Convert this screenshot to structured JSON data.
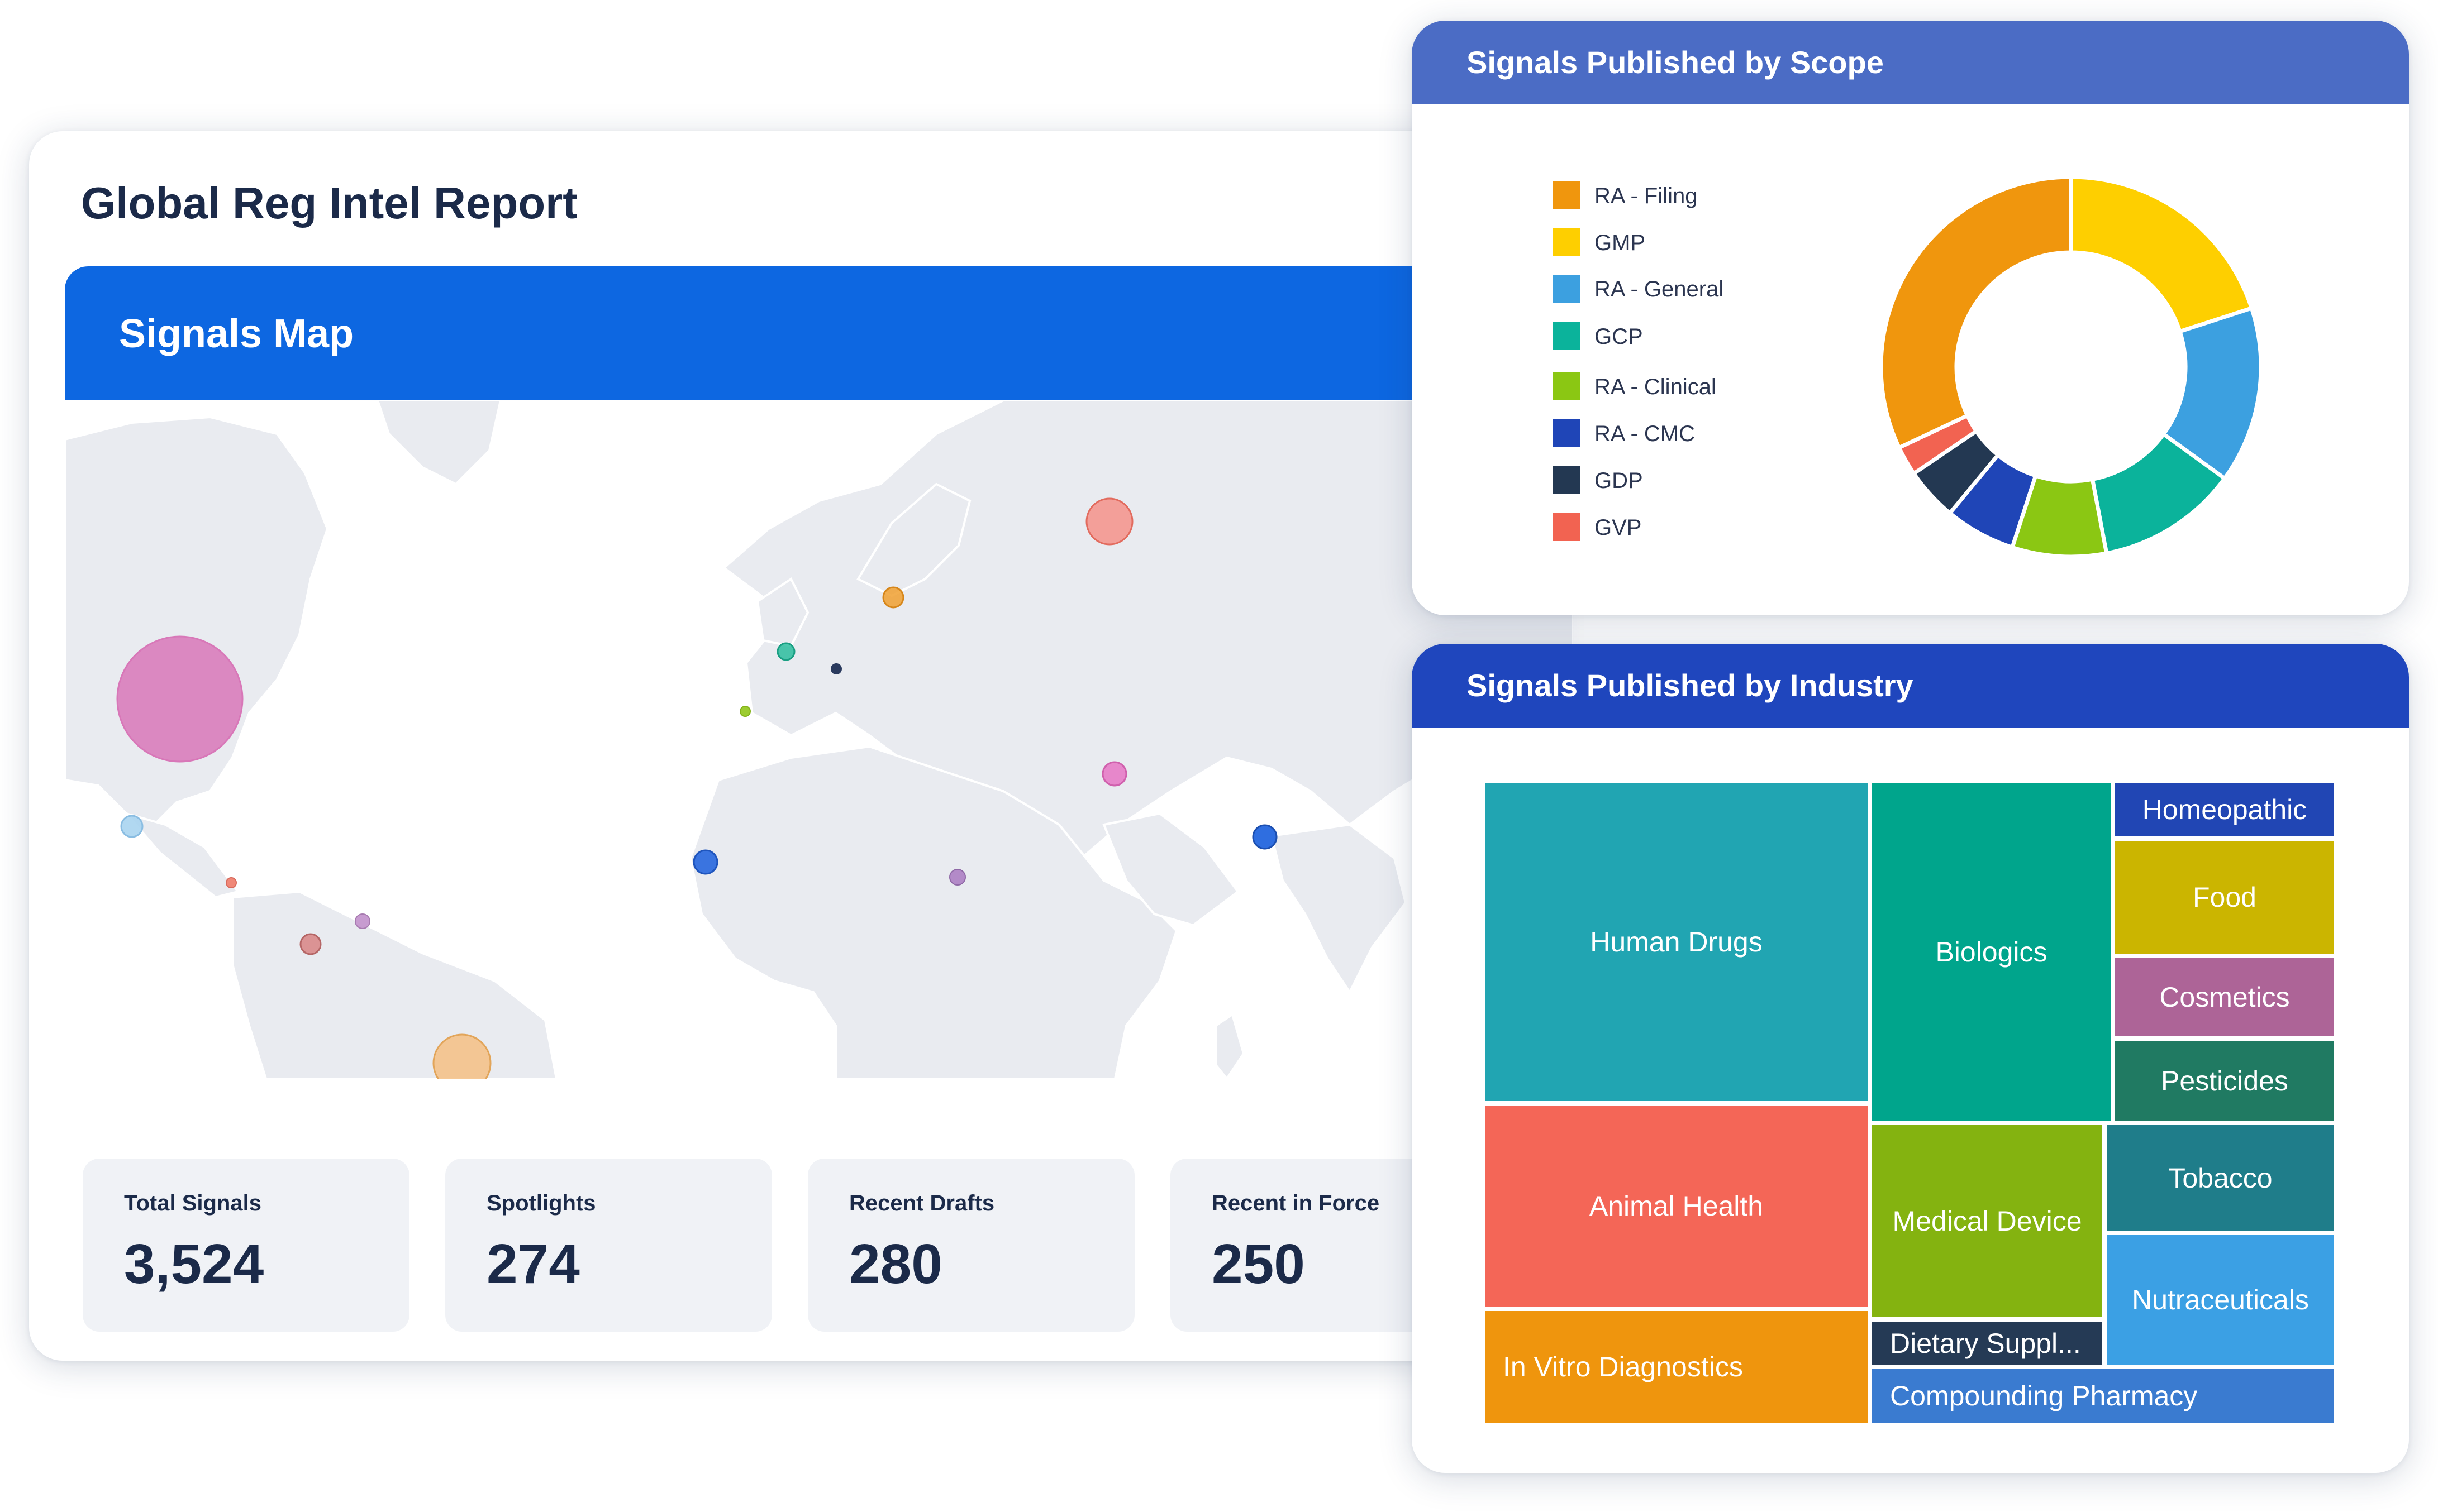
{
  "report": {
    "title": "Global Reg Intel Report"
  },
  "map": {
    "title": "Signals Map"
  },
  "stats": [
    {
      "label": "Total Signals",
      "value": "3,524"
    },
    {
      "label": "Spotlights",
      "value": "274"
    },
    {
      "label": "Recent Drafts",
      "value": "280"
    },
    {
      "label": "Recent in Force",
      "value": "250"
    }
  ],
  "scope": {
    "title": "Signals Published by Scope",
    "header_color": "#4b6cc5",
    "legend": [
      {
        "label": "RA - Filing",
        "color": "#f0960d"
      },
      {
        "label": "GMP",
        "color": "#fecf00"
      },
      {
        "label": "RA - General",
        "color": "#3ca0e0"
      },
      {
        "label": "GCP",
        "color": "#0bb39b"
      },
      {
        "label": "RA - Clinical",
        "color": "#8bc713"
      },
      {
        "label": "RA - CMC",
        "color": "#1f45b7"
      },
      {
        "label": "GDP",
        "color": "#233852"
      },
      {
        "label": "GVP",
        "color": "#f26351"
      }
    ]
  },
  "chart_data": {
    "type": "pie",
    "title": "Signals Published by Scope",
    "labels": [
      "GMP",
      "RA - General",
      "GCP",
      "RA - Clinical",
      "RA - CMC",
      "GDP",
      "GVP",
      "RA - Filing"
    ],
    "values": [
      20,
      15,
      12,
      8,
      6,
      4.5,
      2.5,
      32
    ],
    "colors": [
      "#fecf00",
      "#3ca0e0",
      "#0bb39b",
      "#8bc713",
      "#1f45b7",
      "#233852",
      "#f26351",
      "#f0960d"
    ],
    "legend": "left"
  },
  "industry": {
    "title": "Signals Published by Industry",
    "header_color": "#1f46bd",
    "tiles": [
      {
        "label": "Human Drugs",
        "color": "#21a5b2"
      },
      {
        "label": "Biologics",
        "color": "#00a58c"
      },
      {
        "label": "Homeopathic",
        "color": "#2146b4"
      },
      {
        "label": "Food",
        "color": "#cbb500"
      },
      {
        "label": "Cosmetics",
        "color": "#ad6497"
      },
      {
        "label": "Pesticides",
        "color": "#207a62"
      },
      {
        "label": "Animal Health",
        "color": "#f46657"
      },
      {
        "label": "Medical Device",
        "color": "#84b310"
      },
      {
        "label": "Tobacco",
        "color": "#1f7d8a"
      },
      {
        "label": "Nutraceuticals",
        "color": "#3ba0e4"
      },
      {
        "label": "In Vitro Diagnostics",
        "color": "#ef950d"
      },
      {
        "label": "Dietary Suppl...",
        "color": "#253a55"
      },
      {
        "label": "Compounding Pharmacy",
        "color": "#3a7bd0"
      }
    ]
  },
  "map_markers": [
    {
      "region": "north-america",
      "color": "#d877b8"
    },
    {
      "region": "russia",
      "color": "#f4928a"
    },
    {
      "region": "poland",
      "color": "#f0a030"
    },
    {
      "region": "france",
      "color": "#2bbd9e"
    },
    {
      "region": "italy",
      "color": "#2a3a5e"
    },
    {
      "region": "spain",
      "color": "#9ccc30"
    },
    {
      "region": "iran",
      "color": "#e77cc7"
    },
    {
      "region": "mexico",
      "color": "#a9d4ef"
    },
    {
      "region": "central-america",
      "color": "#f08878"
    },
    {
      "region": "colombia",
      "color": "#d98a8a"
    },
    {
      "region": "venezuela",
      "color": "#c79bd0"
    },
    {
      "region": "brazil",
      "color": "#f5c084"
    },
    {
      "region": "west-africa",
      "color": "#3a74e0"
    },
    {
      "region": "central-africa",
      "color": "#b38ac8"
    },
    {
      "region": "india",
      "color": "#2f6ee0"
    }
  ]
}
